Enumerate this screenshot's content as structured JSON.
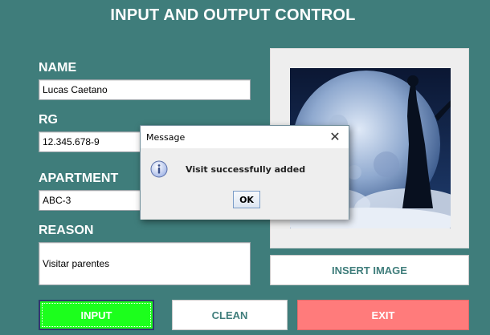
{
  "header": {
    "title": "INPUT AND OUTPUT CONTROL"
  },
  "form": {
    "name_label": "NAME",
    "name_value": "Lucas Caetano",
    "rg_label": "RG",
    "rg_value": "12.345.678-9",
    "apartment_label": "APARTMENT",
    "apartment_value": "ABC-3",
    "reason_label": "REASON",
    "reason_value": "Visitar parentes"
  },
  "buttons": {
    "insert_image": "INSERT IMAGE",
    "input": "INPUT",
    "clean": "CLEAN",
    "exit": "EXIT"
  },
  "dialog": {
    "title": "Message",
    "close": "✕",
    "message": "Visit successfully added",
    "ok": "OK"
  },
  "icons": {
    "info": "info-icon",
    "close": "close-icon"
  },
  "colors": {
    "background": "#3f7d7b",
    "input_button": "#1cff1c",
    "exit_button": "#ff7b7b",
    "accent_text": "#3f7d7b"
  }
}
